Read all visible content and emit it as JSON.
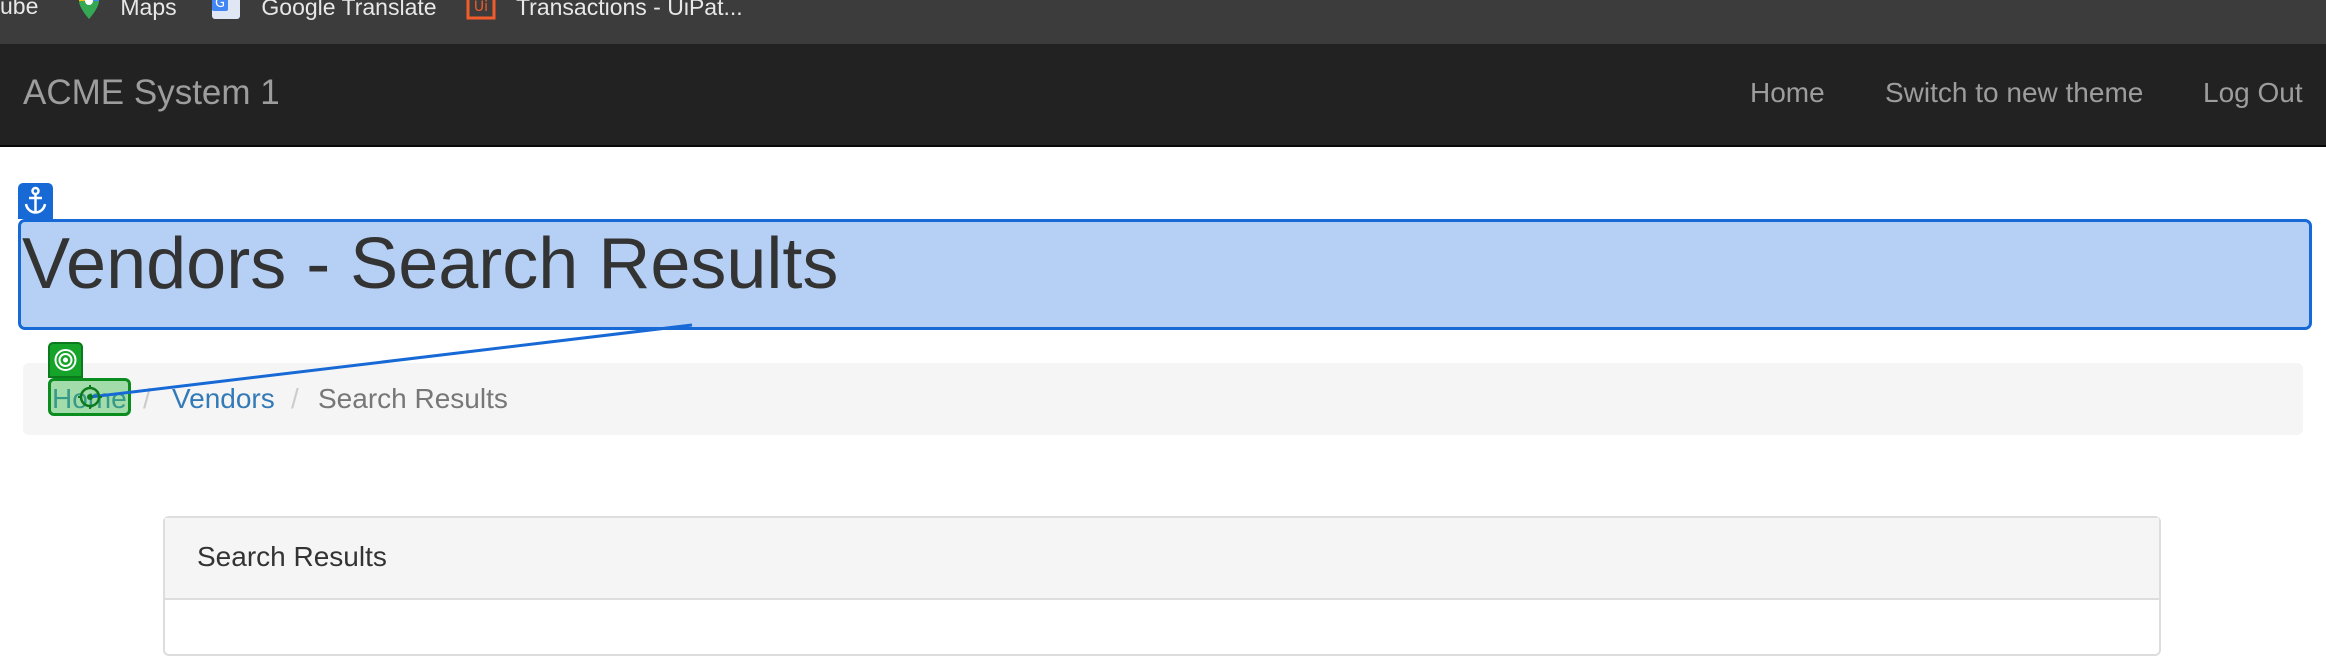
{
  "bookmarks": [
    {
      "label": "ube",
      "icon": "youtube-icon"
    },
    {
      "label": "Maps",
      "icon": "maps-pin-icon",
      "color": "#34a853"
    },
    {
      "label": "Google Translate",
      "icon": "google-translate-icon",
      "color": "#4285f4"
    },
    {
      "label": "Transactions - UiPat...",
      "icon": "uipath-icon",
      "color": "#f25c2a"
    }
  ],
  "navbar": {
    "brand": "ACME System 1",
    "links": [
      "Home",
      "Switch to new theme",
      "Log Out"
    ]
  },
  "page": {
    "title": "Vendors - Search Results"
  },
  "breadcrumb": {
    "items": [
      "Home",
      "Vendors",
      "Search Results"
    ],
    "separator": "/"
  },
  "panel": {
    "heading": "Search Results"
  },
  "overlay": {
    "anchor_icon": "anchor-icon",
    "target_icon": "target-icon",
    "anchor_color": "#1769d6",
    "target_color": "#15a32a"
  }
}
